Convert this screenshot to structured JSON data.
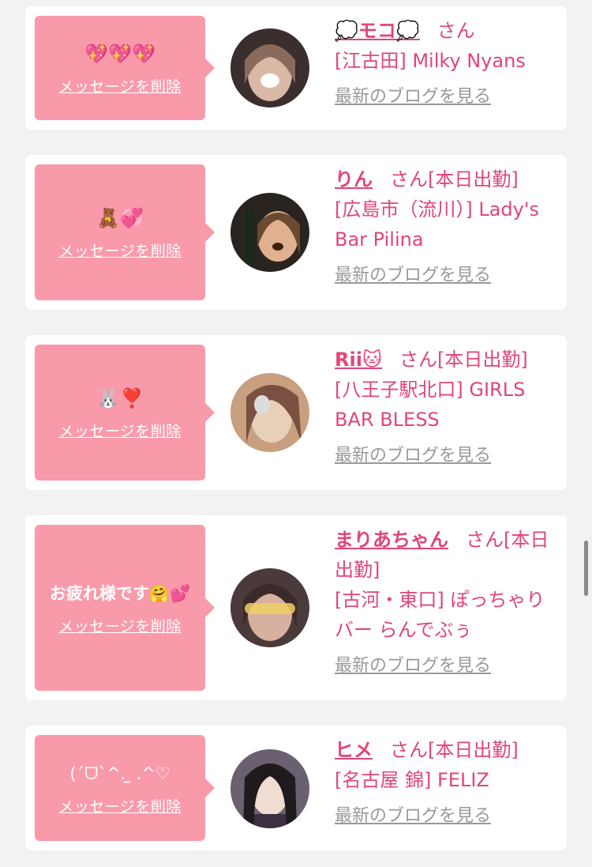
{
  "cards": [
    {
      "message": "💖💖💖",
      "message_emoji": true,
      "delete_label": "メッセージを削除",
      "name": "💭モコ💭",
      "suffix": "さん",
      "shop": "[江古田] Milky Nyans",
      "blog_label": "最新のブログを見る",
      "avatar_colors": [
        "#3a2f2c",
        "#d9b9a5",
        "#8a6a5a"
      ]
    },
    {
      "message": "🧸💞",
      "message_emoji": true,
      "delete_label": "メッセージを削除",
      "name": "りん",
      "suffix": "さん[本日出勤]",
      "shop": "[広島市（流川）] Lady's Bar Pilina",
      "blog_label": "最新のブログを見る",
      "avatar_colors": [
        "#2a2420",
        "#e0b090",
        "#6b4a30"
      ]
    },
    {
      "message": "🐰❣️",
      "message_emoji": true,
      "delete_label": "メッセージを削除",
      "name": "Rii🐱",
      "suffix": "さん[本日出勤]",
      "shop": "[八王子駅北口] GIRLS BAR BLESS",
      "blog_label": "最新のブログを見る",
      "avatar_colors": [
        "#c8a080",
        "#e8d0b8",
        "#7a5040"
      ]
    },
    {
      "message": "お疲れ様です🤗💕",
      "message_emoji": false,
      "delete_label": "メッセージを削除",
      "name": "まりあちゃん",
      "suffix": "さん[本日出勤]",
      "shop": "[古河・東口] ぽっちゃりバー らんでぶぅ",
      "blog_label": "最新のブログを見る",
      "avatar_colors": [
        "#4a3a3a",
        "#d8b0a0",
        "#f0d060"
      ]
    },
    {
      "message": "(ˊᗜˋ^. ̫ .^♡",
      "message_emoji": false,
      "delete_label": "メッセージを削除",
      "name": "ヒメ",
      "suffix": "さん[本日出勤]",
      "shop": "[名古屋 錦] FELIZ",
      "blog_label": "最新のブログを見る",
      "avatar_colors": [
        "#1e1a1e",
        "#f0dcd0",
        "#6a6070"
      ]
    }
  ]
}
